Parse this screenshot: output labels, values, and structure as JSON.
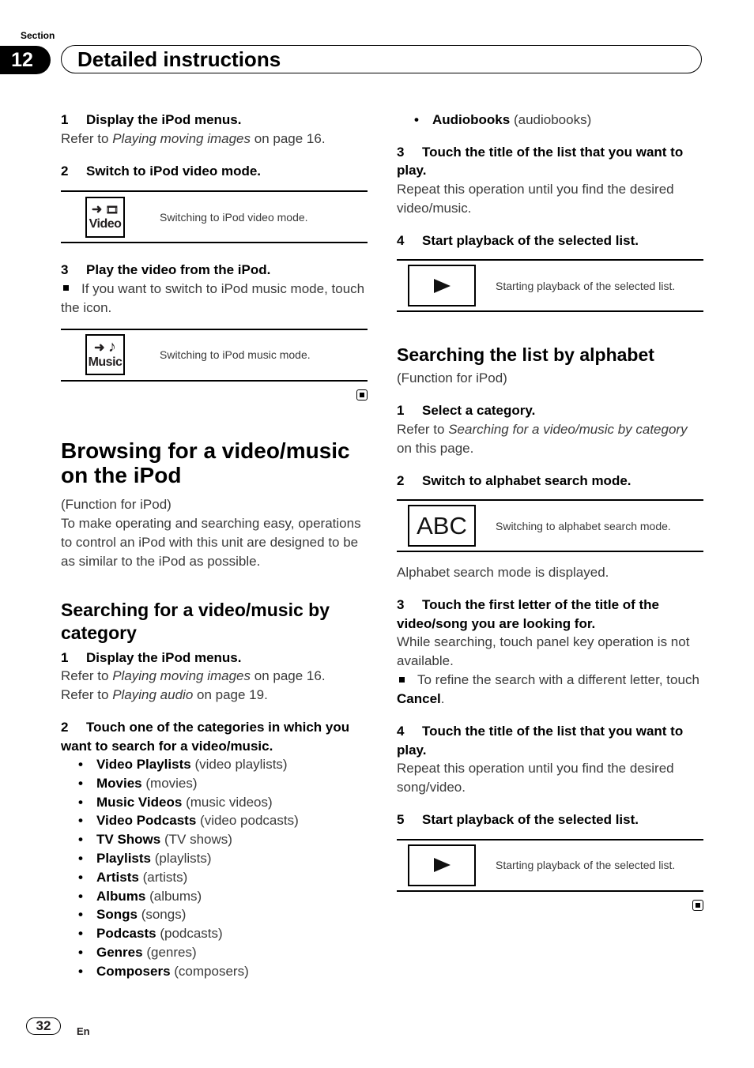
{
  "header": {
    "section_label": "Section",
    "section_number": "12",
    "section_title": "Detailed instructions"
  },
  "left": {
    "step1": {
      "num": "1",
      "title": "Display the iPod menus.",
      "ref_prefix": "Refer to ",
      "ref_italic": "Playing moving images",
      "ref_suffix": " on page 16."
    },
    "step2": {
      "num": "2",
      "title": "Switch to iPod video mode."
    },
    "video_icon": {
      "arrow": "➜",
      "glyph": "🎞",
      "label": "Video",
      "caption": "Switching to iPod video mode."
    },
    "step3": {
      "num": "3",
      "title": "Play the video from the iPod.",
      "note": "If you want to switch to iPod music mode, touch the icon."
    },
    "music_icon": {
      "arrow": "➜",
      "glyph": "♪",
      "label": "Music",
      "caption": "Switching to iPod music mode."
    },
    "browse": {
      "heading": "Browsing for a video/music on the iPod",
      "function": "(Function for iPod)",
      "intro": "To make operating and searching easy, operations to control an iPod with this unit are designed to be as similar to the iPod as possible."
    },
    "category": {
      "heading": "Searching for a video/music by category",
      "step1": {
        "num": "1",
        "title": "Display the iPod menus.",
        "ref1_prefix": "Refer to ",
        "ref1_italic": "Playing moving images",
        "ref1_suffix": " on page 16.",
        "ref2_prefix": "Refer to ",
        "ref2_italic": "Playing audio",
        "ref2_suffix": " on page 19."
      },
      "step2": {
        "num": "2",
        "title": "Touch one of the categories in which you want to search for a video/music."
      },
      "items": [
        {
          "name": "Video Playlists",
          "desc": "(video playlists)"
        },
        {
          "name": "Movies",
          "desc": "(movies)"
        },
        {
          "name": "Music Videos",
          "desc": "(music videos)"
        },
        {
          "name": "Video Podcasts",
          "desc": "(video podcasts)"
        },
        {
          "name": "TV Shows",
          "desc": "(TV shows)"
        },
        {
          "name": "Playlists",
          "desc": "(playlists)"
        },
        {
          "name": "Artists",
          "desc": "(artists)"
        },
        {
          "name": "Albums",
          "desc": "(albums)"
        },
        {
          "name": "Songs",
          "desc": "(songs)"
        },
        {
          "name": "Podcasts",
          "desc": "(podcasts)"
        },
        {
          "name": "Genres",
          "desc": "(genres)"
        },
        {
          "name": "Composers",
          "desc": "(composers)"
        }
      ]
    }
  },
  "right": {
    "audiobooks": {
      "name": "Audiobooks",
      "desc": "(audiobooks)"
    },
    "step3": {
      "num": "3",
      "title": "Touch the title of the list that you want to play.",
      "body": "Repeat this operation until you find the desired video/music."
    },
    "step4": {
      "num": "4",
      "title": "Start playback of the selected list."
    },
    "play1_caption": "Starting playback of the selected list.",
    "alphabet": {
      "heading": "Searching the list by alphabet",
      "function": "(Function for iPod)",
      "step1": {
        "num": "1",
        "title": "Select a category.",
        "ref_prefix": "Refer to ",
        "ref_italic": "Searching for a video/music by category",
        "ref_suffix": " on this page."
      },
      "step2": {
        "num": "2",
        "title": "Switch to alphabet search mode."
      },
      "abc_icon": {
        "label": "ABC",
        "caption": "Switching to alphabet search mode."
      },
      "mode_displayed": "Alphabet search mode is displayed.",
      "step3": {
        "num": "3",
        "title": "Touch the first letter of the title of the video/song you are looking for.",
        "body": "While searching, touch panel key operation is not available.",
        "note_prefix": "To refine the search with a different letter, touch ",
        "note_bold": "Cancel",
        "note_suffix": "."
      },
      "step4": {
        "num": "4",
        "title": "Touch the title of the list that you want to play.",
        "body": "Repeat this operation until you find the desired song/video."
      },
      "step5": {
        "num": "5",
        "title": "Start playback of the selected list."
      },
      "play2_caption": "Starting playback of the selected list."
    }
  },
  "footer": {
    "page_number": "32",
    "language": "En"
  }
}
